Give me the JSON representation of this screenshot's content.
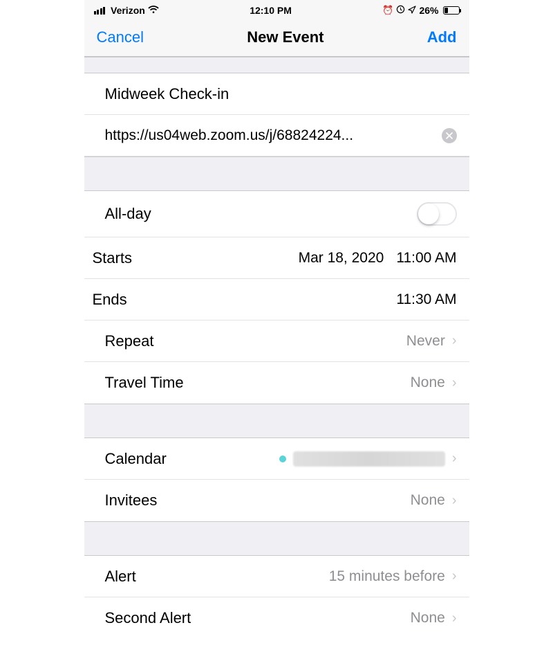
{
  "status": {
    "carrier": "Verizon",
    "time": "12:10 PM",
    "battery_pct": "26%"
  },
  "nav": {
    "cancel": "Cancel",
    "title": "New Event",
    "add": "Add"
  },
  "event": {
    "title": "Midweek Check-in",
    "location": "https://us04web.zoom.us/j/68824224..."
  },
  "time": {
    "allday_label": "All-day",
    "starts_label": "Starts",
    "starts_date": "Mar 18, 2020",
    "starts_time": "11:00 AM",
    "ends_label": "Ends",
    "ends_time": "11:30 AM",
    "repeat_label": "Repeat",
    "repeat_value": "Never",
    "travel_label": "Travel Time",
    "travel_value": "None"
  },
  "calendar": {
    "label": "Calendar",
    "dot_color": "#5ad4d8",
    "invitees_label": "Invitees",
    "invitees_value": "None"
  },
  "alerts": {
    "alert_label": "Alert",
    "alert_value": "15 minutes before",
    "second_label": "Second Alert",
    "second_value": "None"
  }
}
